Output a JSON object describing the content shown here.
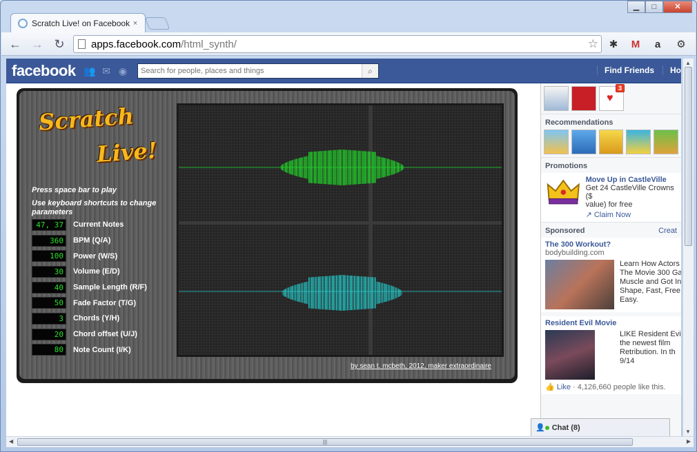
{
  "browser": {
    "tab_title": "Scratch Live! on Facebook",
    "url_host": "apps.facebook.com",
    "url_path": "/html_synth/",
    "tab_close_glyph": "×",
    "window_buttons": {
      "minimize": "▁",
      "maximize": "□",
      "close": "✕"
    },
    "nav": {
      "back": "←",
      "forward": "→",
      "reload": "↻"
    }
  },
  "facebook": {
    "logo": "facebook",
    "search_placeholder": "Search for people, places and things",
    "links": [
      "Find Friends",
      "Ho"
    ]
  },
  "synth": {
    "logo_line1": "Scratch",
    "logo_line2": "Live!",
    "instruction1": "Press space bar to play",
    "instruction2": "Use keyboard shortcuts to change parameters",
    "params": [
      {
        "value": "47, 37",
        "label": "Current Notes"
      },
      {
        "value": "360",
        "label": "BPM (Q/A)"
      },
      {
        "value": "100",
        "label": "Power (W/S)"
      },
      {
        "value": "30",
        "label": "Volume (E/D)"
      },
      {
        "value": "40",
        "label": "Sample Length (R/F)"
      },
      {
        "value": "50",
        "label": "Fade Factor (T/G)"
      },
      {
        "value": "3",
        "label": "Chords (Y/H)"
      },
      {
        "value": "20",
        "label": "Chord offset (U/J)"
      },
      {
        "value": "80",
        "label": "Note Count (I/K)"
      }
    ],
    "credit": "by sean t. mcbeth, 2012, maker extraordinaire",
    "colors": {
      "wave_top": "#22d42a",
      "wave_bottom": "#26c6c6",
      "lcd_text": "#27e02a"
    }
  },
  "sidebar": {
    "app_badge": "3",
    "recommendations_title": "Recommendations",
    "promotions_title": "Promotions",
    "promo": {
      "title": "Move Up in CastleVille",
      "text": "Get 24 CastleVille Crowns ($",
      "text2": "value) for free",
      "claim": "Claim Now"
    },
    "sponsored_title": "Sponsored",
    "create_link": "Creat",
    "ads": [
      {
        "title": "The 300 Workout?",
        "domain": "bodybuilding.com",
        "lines": [
          "Learn How Actors",
          "The Movie 300 Ga",
          "Muscle and Got In",
          "Shape, Fast, Free",
          "Easy."
        ]
      },
      {
        "title": "Resident Evil Movie",
        "lines": [
          "LIKE Resident Evil",
          "the newest film",
          "Retribution. In th",
          "9/14"
        ],
        "like_label": "Like",
        "like_count": "· 4,126,660 people like this."
      }
    ]
  },
  "chat": {
    "label": "Chat (8)"
  }
}
